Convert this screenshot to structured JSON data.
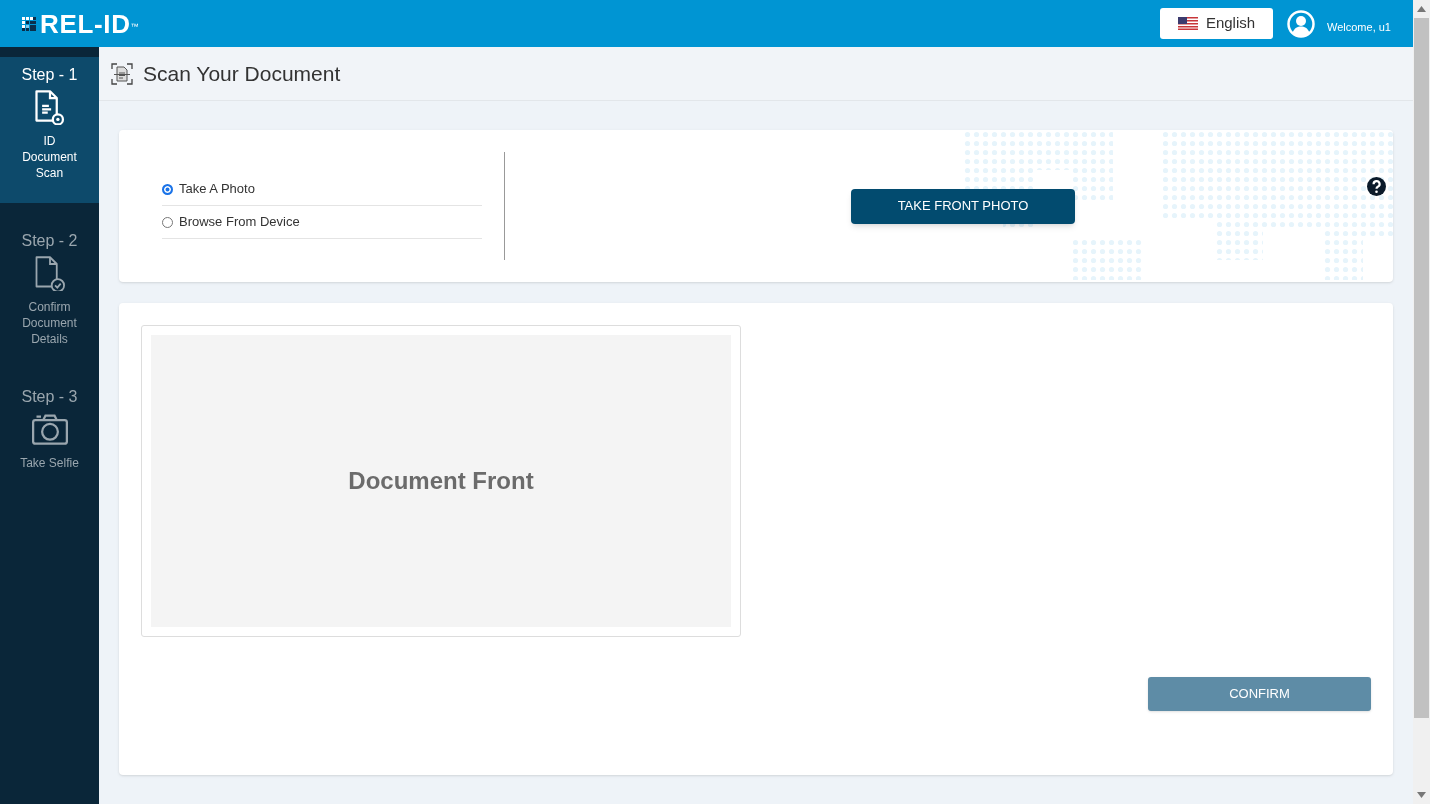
{
  "header": {
    "logo": "REL-ID$^{™}$",
    "language": "English",
    "welcome": "Welcome, u1"
  },
  "steps": [
    {
      "step": "Step - 1",
      "label": "ID Document Scan",
      "selected": true
    },
    {
      "step": "Step - 2",
      "label": "Confirm Document Details",
      "selected": false
    },
    {
      "step": "Step - 3",
      "label": "Take Selfie",
      "selected": false
    }
  ],
  "page_title": "Scan Your Document",
  "capture_options": [
    {
      "label": "Take A Photo",
      "selected": true
    },
    {
      "label": "Browse From Device",
      "selected": false
    }
  ],
  "take_photo_button": "TAKE FRONT PHOTO",
  "preview_label": "Document Front",
  "confirm_button": "CONFIRM"
}
